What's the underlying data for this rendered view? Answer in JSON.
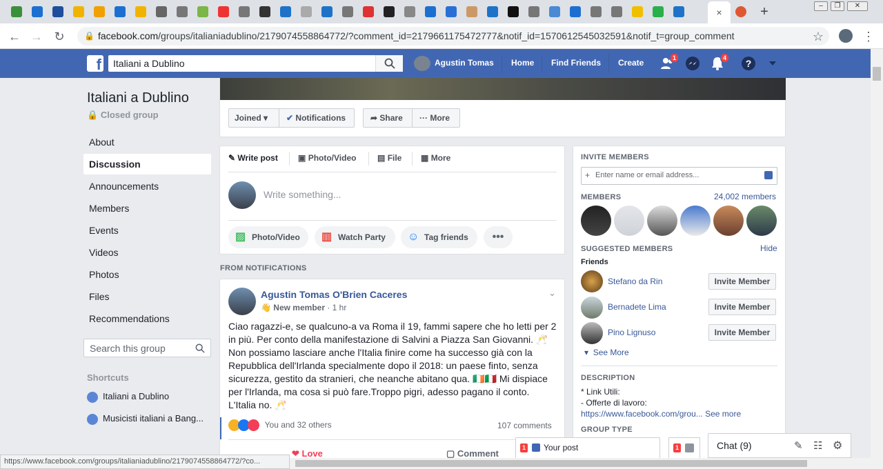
{
  "browser": {
    "tab_close": "×",
    "newtab": "+",
    "tab_colors": [
      "#3a8f3a",
      "#1c6fd1",
      "#1f4e9c",
      "#f0b400",
      "#f0a000",
      "#1c6fd1",
      "#f0b400",
      "#666",
      "#777",
      "#7ab648",
      "#e33",
      "#777",
      "#333",
      "#1e73c8",
      "#aaa",
      "#1e73c8",
      "#777",
      "#d33",
      "#222",
      "#888",
      "#1c6fd1",
      "#2a6fd6",
      "#c96",
      "#1e73c8",
      "#111",
      "#777",
      "#4a8ad4",
      "#1c6fd1",
      "#777",
      "#777",
      "#f0c000",
      "#2ab04a",
      "#1e73c8"
    ],
    "url_host": "facebook.com",
    "url_path": "/groups/italianiadublino/2179074558864772/?comment_id=2179661175472777&notif_id=1570612545032591&notif_t=group_comment",
    "status_url": "https://www.facebook.com/groups/italianiadublino/2179074558864772/?co..."
  },
  "fb": {
    "logo": "f",
    "search_value": "Italiani a Dublino",
    "user": "Agustin Tomas",
    "nav": [
      "Home",
      "Find Friends",
      "Create"
    ],
    "friend_badge": "1",
    "notif_badge": "4"
  },
  "group": {
    "name": "Italiani a Dublino",
    "privacy": "Closed group",
    "nav": [
      "About",
      "Discussion",
      "Announcements",
      "Members",
      "Events",
      "Videos",
      "Photos",
      "Files",
      "Recommendations"
    ],
    "search_placeholder": "Search this group",
    "shortcuts_label": "Shortcuts",
    "shortcuts": [
      "Italiani a Dublino",
      "Musicisti italiani a Bang..."
    ]
  },
  "actions": {
    "joined": "Joined",
    "notifications": "Notifications",
    "share": "Share",
    "more": "More"
  },
  "composer": {
    "tabs": [
      "Write post",
      "Photo/Video",
      "File",
      "More"
    ],
    "placeholder": "Write something...",
    "pills": [
      "Photo/Video",
      "Watch Party",
      "Tag friends"
    ]
  },
  "feed": {
    "label": "FROM NOTIFICATIONS",
    "post": {
      "author": "Agustin Tomas O'Brien Caceres",
      "badge": "New member",
      "time": "1 hr",
      "text": "Ciao ragazzi-e, se qualcuno-a va Roma il 19, fammi sapere che ho letti per 2 in più. Per conto della manifestazione di Salvini a Piazza San Giovanni. 🥂 Non possiamo lasciare anche l'Italia finire come ha successo già con la Repubblica dell'Irlanda specialmente dopo il 2018: un paese finto, senza sicurezza, gestito da stranieri, che neanche abitano qua. 🇮🇪🇮🇹 Mi dispiace per l'Irlanda, ma cosa si può fare.Troppo pigri, adesso pagano il conto. L'Italia no. 🥂",
      "reactions": "You and 32 others",
      "comments": "107 comments",
      "love": "Love",
      "comment": "Comment"
    }
  },
  "sidebar": {
    "invite_label": "INVITE MEMBERS",
    "invite_placeholder": "Enter name or email address...",
    "members_label": "MEMBERS",
    "members_count": "24,002 members",
    "suggested_label": "SUGGESTED MEMBERS",
    "hide": "Hide",
    "friends_label": "Friends",
    "suggested": [
      "Stefano da Rin",
      "Bernadete Lima",
      "Pino Lignuso"
    ],
    "invite_btn": "Invite Member",
    "see_more": "See More",
    "description_label": "DESCRIPTION",
    "desc_line1": "* Link Utili:",
    "desc_line2": "- Offerte di lavoro:",
    "desc_link": "https://www.facebook.com/grou...",
    "desc_more": "See more",
    "group_type_label": "GROUP TYPE"
  },
  "chat": {
    "your_post": "Your post",
    "chat_label": "Chat (9)",
    "badge": "1"
  }
}
